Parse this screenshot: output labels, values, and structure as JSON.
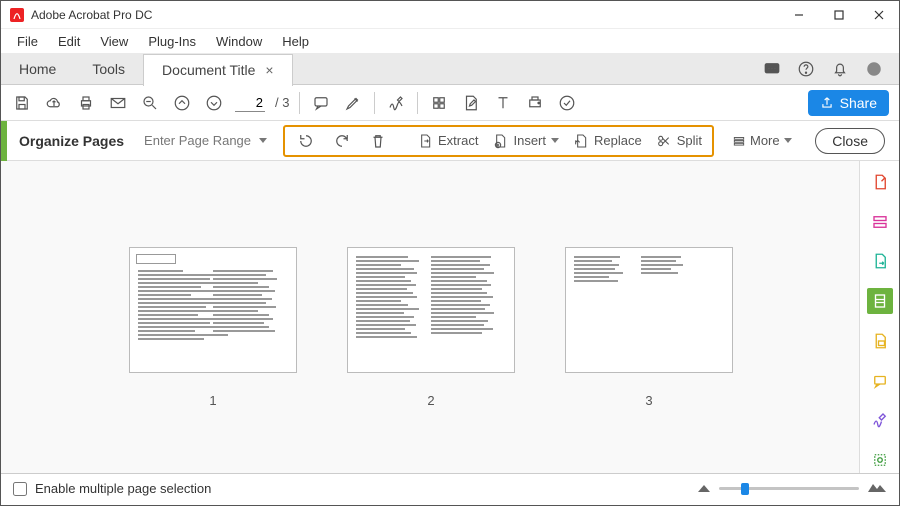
{
  "app": {
    "title": "Adobe Acrobat Pro DC"
  },
  "menubar": [
    "File",
    "Edit",
    "View",
    "Plug-Ins",
    "Window",
    "Help"
  ],
  "tabs": {
    "home": "Home",
    "tools": "Tools",
    "doc": {
      "label": "Document Title",
      "active": true
    }
  },
  "toolbar": {
    "page_current": "2",
    "page_total": "/ 3"
  },
  "share_label": "Share",
  "organize": {
    "title": "Organize Pages",
    "page_range_placeholder": "Enter Page Range",
    "buttons": {
      "extract": "Extract",
      "insert": "Insert",
      "replace": "Replace",
      "split": "Split"
    },
    "more": "More",
    "close": "Close"
  },
  "pages": [
    "1",
    "2",
    "3"
  ],
  "footer": {
    "checkbox_label": "Enable multiple page selection"
  }
}
